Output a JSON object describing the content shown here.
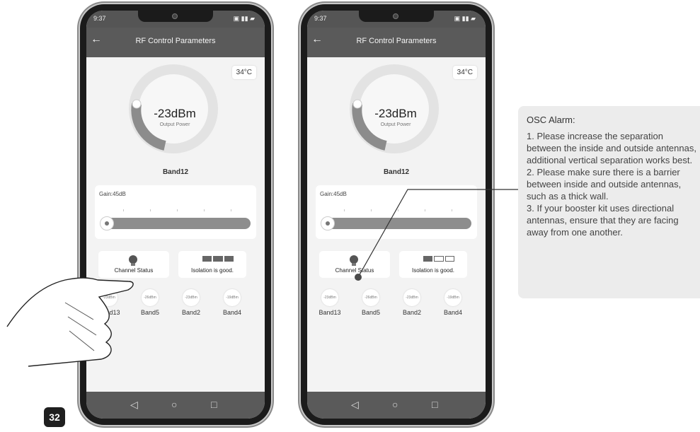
{
  "phones": [
    {
      "status_time": "9:37",
      "app_title": "RF Control Parameters",
      "temperature": "34°C",
      "power_value": "-23dBm",
      "power_label": "Output Power",
      "band_name": "Band12",
      "gain_label": "Gain:45dB",
      "channel_status_label": "Channel Status",
      "isolation_label": "Isolation is good.",
      "bands": [
        {
          "power": "-23dBm",
          "name": "Band13"
        },
        {
          "power": "-26dBm",
          "name": "Band5"
        },
        {
          "power": "-23dBm",
          "name": "Band2"
        },
        {
          "power": "-19dBm",
          "name": "Band4"
        }
      ],
      "isolation_filled_bars": 3
    },
    {
      "status_time": "9:37",
      "app_title": "RF Control Parameters",
      "temperature": "34°C",
      "power_value": "-23dBm",
      "power_label": "Output Power",
      "band_name": "Band12",
      "gain_label": "Gain:45dB",
      "channel_status_label": "Channel Status",
      "isolation_label": "Isolation is good.",
      "bands": [
        {
          "power": "-23dBm",
          "name": "Band13"
        },
        {
          "power": "-26dBm",
          "name": "Band5"
        },
        {
          "power": "-23dBm",
          "name": "Band2"
        },
        {
          "power": "-19dBm",
          "name": "Band4"
        }
      ],
      "isolation_filled_bars": 1
    }
  ],
  "note": {
    "title": "OSC Alarm:",
    "body": "1. Please increase the separation between the inside and outside antennas, additional vertical separation works best.\n2. Please make sure there is a barrier between inside and outside antennas, such as a thick wall.\n3. If your booster kit uses directional antennas, ensure that they are facing away from one another."
  },
  "page_number": "32",
  "icons": {
    "back": "back-arrow-icon",
    "nav_back": "nav-back-icon",
    "nav_home": "nav-home-icon",
    "nav_recent": "nav-recent-icon",
    "channel": "bulb-icon"
  },
  "colors": {
    "appbar": "#5a5a5a",
    "navbar": "#5a5a5a",
    "gauge": "#7f7f7f",
    "track": "#8d8d8d",
    "note_bg": "#ececec"
  }
}
